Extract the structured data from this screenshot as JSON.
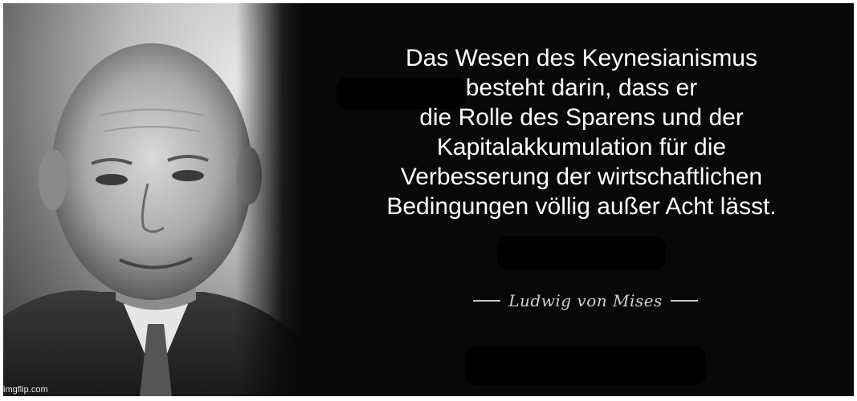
{
  "quote": {
    "lines": [
      "Das Wesen des Keynesianismus",
      "besteht darin, dass er",
      "die Rolle des Sparens und der",
      "Kapitalakkumulation für die",
      "Verbesserung der wirtschaftlichen",
      "Bedingungen völlig außer Acht lässt."
    ]
  },
  "attribution": {
    "author": "Ludwig von Mises"
  },
  "watermark": {
    "text": "imgflip.com"
  },
  "colors": {
    "background": "#080808",
    "text": "#ffffff",
    "attribution": "#c8c8c8",
    "frame": "#ffffff"
  }
}
